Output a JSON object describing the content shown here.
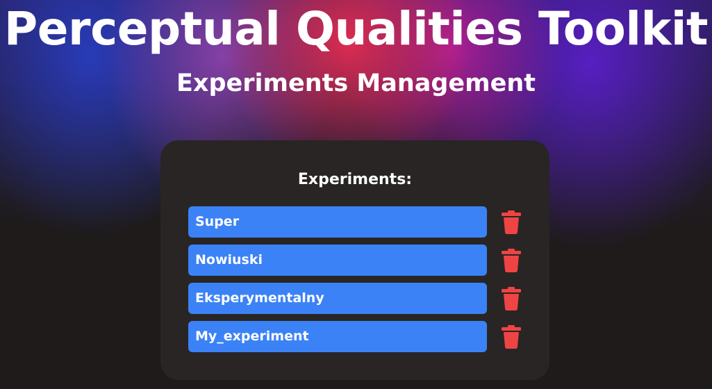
{
  "header": {
    "title": "Perceptual Qualities Toolkit",
    "subtitle": "Experiments Management"
  },
  "panel": {
    "heading": "Experiments:",
    "experiments": [
      {
        "name": "Super"
      },
      {
        "name": "Nowiuski"
      },
      {
        "name": "Eksperymentalny"
      },
      {
        "name": "My_experiment"
      }
    ],
    "delete_icon": "trash-icon"
  },
  "colors": {
    "page_background": "#1e1b1a",
    "panel_background": "#282524",
    "experiment_button": "#3b82f6",
    "delete_icon": "#ef4444",
    "text": "#ffffff"
  }
}
